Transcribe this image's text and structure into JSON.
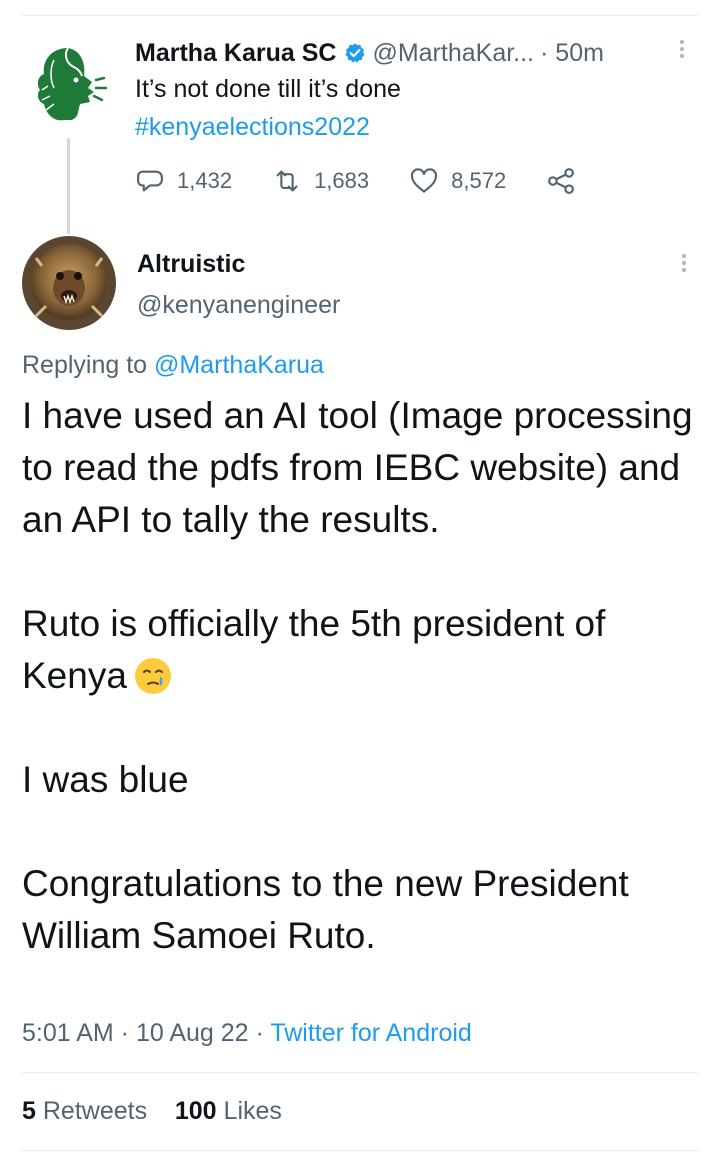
{
  "parent_tweet": {
    "display_name": "Martha Karua SC",
    "handle": "@MarthaKar...",
    "time": "· 50m",
    "text": "It’s not done till it’s done",
    "hashtag": "#kenyaelections2022",
    "replies": "1,432",
    "retweets": "1,683",
    "likes": "8,572",
    "avatar_icon": "woman-profile-silhouette-logo",
    "verified_icon": "verified-badge-icon",
    "accent_color": "#1d9bf0",
    "avatar_color": "#1f7a3a"
  },
  "main_tweet": {
    "display_name": "Altruistic",
    "handle": "@kenyanengineer",
    "replying_label": "Replying to",
    "replying_handle": "@MarthaKarua",
    "paragraph_1": "I have used an AI tool (Image processing to read the pdfs from IEBC website) and an  API to tally the results.",
    "paragraph_2": "Ruto is officially the 5th president of Kenya",
    "emoji": "crying-face-emoji",
    "paragraph_3": "I was blue",
    "paragraph_4": "Congratulations to the new President William Samoei Ruto.",
    "timestamp": "5:01 AM · 10 Aug 22 ·",
    "source": "Twitter for Android",
    "retweet_count": "5",
    "retweet_label": "Retweets",
    "like_count": "100",
    "like_label": "Likes"
  }
}
